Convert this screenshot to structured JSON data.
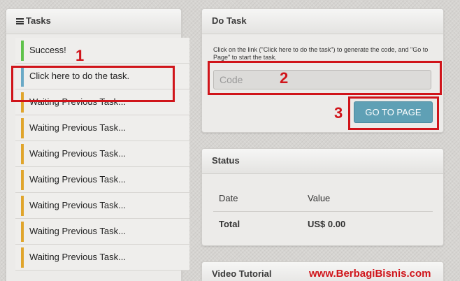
{
  "tasks_panel": {
    "title": "Tasks",
    "items": [
      {
        "label": "Success!",
        "state": "success"
      },
      {
        "label": "Click here to do the task.",
        "state": "active"
      },
      {
        "label": "Waiting Previous Task...",
        "state": "waiting"
      },
      {
        "label": "Waiting Previous Task...",
        "state": "waiting"
      },
      {
        "label": "Waiting Previous Task...",
        "state": "waiting"
      },
      {
        "label": "Waiting Previous Task...",
        "state": "waiting"
      },
      {
        "label": "Waiting Previous Task...",
        "state": "waiting"
      },
      {
        "label": "Waiting Previous Task...",
        "state": "waiting"
      },
      {
        "label": "Waiting Previous Task...",
        "state": "waiting"
      }
    ]
  },
  "do_task_panel": {
    "title": "Do Task",
    "instructions": "Click on the link (\"Click here to do the task\") to generate the code, and \"Go to Page\" to start the task.",
    "code_placeholder": "Code",
    "code_value": "",
    "goto_label": "GO TO PAGE"
  },
  "status_panel": {
    "title": "Status",
    "col_date": "Date",
    "col_value": "Value",
    "total_label": "Total",
    "total_value": "US$ 0.00"
  },
  "video_panel": {
    "title": "Video Tutorial"
  },
  "annotations": {
    "n1": "1",
    "n2": "2",
    "n3": "3",
    "watermark": "www.BerbagiBisnis.com"
  },
  "colors": {
    "success": "#5fc24b",
    "active": "#6aa9c6",
    "waiting": "#e0a52c",
    "button": "#5fa0b5",
    "annotation_red": "#d0141a"
  },
  "icons": {
    "tasks_header": "menu-icon"
  }
}
